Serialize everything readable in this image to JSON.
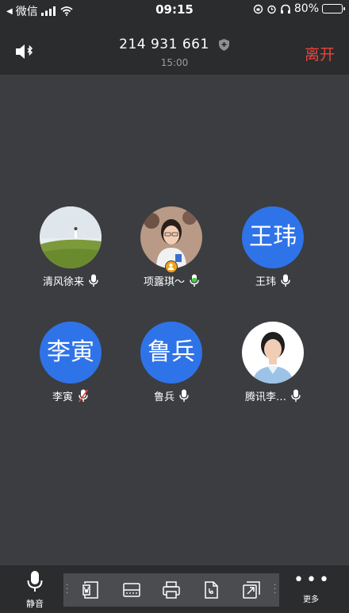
{
  "status_bar": {
    "back_app": "微信",
    "time": "09:15",
    "battery": "80%",
    "battery_level": 0.8
  },
  "header": {
    "meeting_id": "214 931 661",
    "duration": "15:00",
    "leave_label": "离开"
  },
  "participants": [
    {
      "name": "清风徐来",
      "avatar_type": "photo",
      "mic": "on"
    },
    {
      "name": "项露琪～",
      "avatar_type": "photo",
      "mic": "speaking",
      "host": true
    },
    {
      "name": "王玮",
      "avatar_type": "text",
      "avatar_text": "王玮",
      "mic": "on"
    },
    {
      "name": "李寅",
      "avatar_type": "text",
      "avatar_text": "李寅",
      "mic": "muted"
    },
    {
      "name": "鲁兵",
      "avatar_type": "text",
      "avatar_text": "鲁兵",
      "mic": "on"
    },
    {
      "name": "腾讯李…",
      "avatar_type": "photo",
      "mic": "on"
    }
  ],
  "bottom_bar": {
    "mute_label": "静音",
    "more_label": "更多",
    "toolbar_icons": [
      "word-doc-icon",
      "scanner-icon",
      "printer-icon",
      "pdf-icon",
      "resize-icon"
    ]
  },
  "colors": {
    "accent_blue": "#2f73e9",
    "leave_red": "#e8453c",
    "speaking_green": "#3bd13b",
    "host_orange": "#f0a31a"
  }
}
